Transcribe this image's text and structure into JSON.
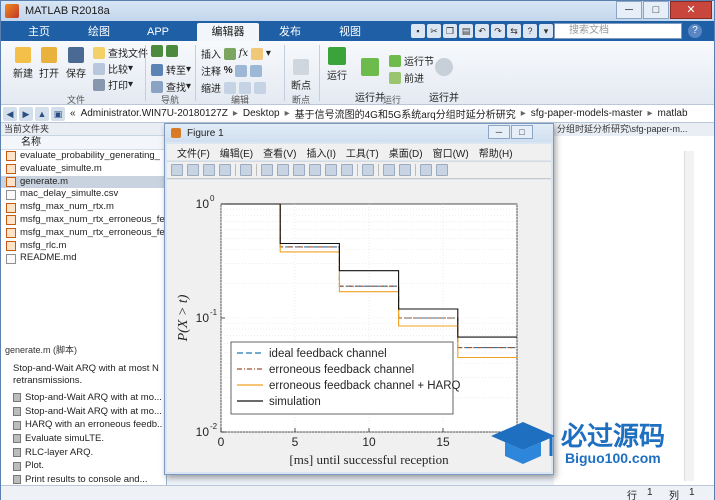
{
  "app": {
    "title": "MATLAB R2018a"
  },
  "window_controls": {
    "minimize": "─",
    "maximize": "□",
    "close": "✕"
  },
  "tabs": [
    {
      "label": "主页",
      "active": false
    },
    {
      "label": "绘图",
      "active": false
    },
    {
      "label": "APP",
      "active": false
    },
    {
      "label": "编辑器",
      "active": true
    },
    {
      "label": "发布",
      "active": false
    },
    {
      "label": "视图",
      "active": false
    }
  ],
  "search": {
    "placeholder": "搜索文档"
  },
  "ribbon": {
    "file": {
      "new": "新建",
      "open": "打开",
      "save": "保存",
      "find_files": "查找文件",
      "compare": "比较",
      "print": "打印",
      "group": "文件"
    },
    "navigate": {
      "goto": "转至",
      "find": "查找",
      "group": "导航"
    },
    "edit": {
      "insert": "插入",
      "comment": "注释",
      "indent": "缩进",
      "group": "编辑"
    },
    "breakpoints": {
      "label": "断点",
      "group": "断点"
    },
    "run": {
      "run": "运行",
      "run_advance": "运行并\n前进",
      "run_section": "运行节",
      "advance": "前进",
      "run_time": "运行并\n计时",
      "group": "运行"
    }
  },
  "address": {
    "crumbs": [
      "«",
      "Administrator.WIN7U-20180127Z",
      "Desktop",
      "基于信号流图的4G和5G系统arq分组时延分析研究",
      "sfg-paper-models-master",
      "matlab"
    ]
  },
  "current_folder": {
    "header": "当前文件夹",
    "column": "名称",
    "files": [
      {
        "name": "evaluate_probability_generating_",
        "type": "m",
        "selected": false
      },
      {
        "name": "evaluate_simulte.m",
        "type": "m",
        "selected": false
      },
      {
        "name": "generate.m",
        "type": "m",
        "selected": true
      },
      {
        "name": "mac_delay_simulte.csv",
        "type": "csv",
        "selected": false
      },
      {
        "name": "msfg_max_num_rtx.m",
        "type": "m",
        "selected": false
      },
      {
        "name": "msfg_max_num_rtx_erroneous_fee",
        "type": "m",
        "selected": false
      },
      {
        "name": "msfg_max_num_rtx_erroneous_fe",
        "type": "m",
        "selected": false
      },
      {
        "name": "msfg_rlc.m",
        "type": "m",
        "selected": false
      },
      {
        "name": "README.md",
        "type": "md",
        "selected": false
      }
    ]
  },
  "details": {
    "header": "generate.m  (脚本)",
    "text": "Stop-and-Wait ARQ with at most N retransmissions.",
    "items": [
      "Stop-and-Wait ARQ with at mo...",
      "Stop-and-Wait ARQ with at mo...",
      "HARQ with an erroneous feedb...",
      "Evaluate simuLTE.",
      "RLC-layer ARQ.",
      "Plot.",
      "Print results to console and..."
    ]
  },
  "editor_tab": {
    "label": "分组时延分析研究\\sfg-paper-m..."
  },
  "status": {
    "row_label": "行",
    "row_value": "1",
    "col_label": "列",
    "col_value": "1"
  },
  "figure": {
    "title": "Figure 1",
    "menu": [
      "文件(F)",
      "编辑(E)",
      "查看(V)",
      "插入(I)",
      "工具(T)",
      "桌面(D)",
      "窗口(W)",
      "帮助(H)"
    ]
  },
  "chart_data": {
    "type": "line",
    "xlabel": "[ms]  until successful reception",
    "ylabel": "P(X > t)",
    "xlim": [
      0,
      20
    ],
    "ylim": [
      0.01,
      1
    ],
    "yscale": "log",
    "x_ticks": [
      0,
      5,
      10,
      15
    ],
    "y_ticks": [
      {
        "value": 1,
        "label_base": "10",
        "label_exp": "0"
      },
      {
        "value": 0.1,
        "label_base": "10",
        "label_exp": "-1"
      },
      {
        "value": 0.01,
        "label_base": "10",
        "label_exp": "-2"
      }
    ],
    "grid": true,
    "legend_position": "bottom-left",
    "series": [
      {
        "name": "ideal feedback channel",
        "color": "#1f77b4",
        "dash": "6,3",
        "x": [
          0,
          4,
          4,
          8,
          8,
          12,
          12,
          16,
          16,
          20
        ],
        "y": [
          1,
          1,
          0.42,
          0.42,
          0.19,
          0.19,
          0.1,
          0.1,
          0.055,
          0.055
        ]
      },
      {
        "name": "erroneous feedback channel",
        "color": "#a0522d",
        "dash": "5,2,1,2",
        "x": [
          0,
          4,
          4,
          8,
          8,
          12,
          12,
          16,
          16,
          20
        ],
        "y": [
          1,
          1,
          0.42,
          0.42,
          0.19,
          0.19,
          0.1,
          0.1,
          0.055,
          0.055
        ]
      },
      {
        "name": "erroneous feedback channel + HARQ",
        "color": "#f0a020",
        "dash": "",
        "x": [
          0,
          4,
          4,
          8,
          8,
          12,
          12,
          16,
          16,
          20
        ],
        "y": [
          1,
          1,
          0.38,
          0.38,
          0.17,
          0.17,
          0.085,
          0.085,
          0.045,
          0.045
        ]
      },
      {
        "name": "simulation",
        "color": "#111111",
        "dash": "",
        "x": [
          0,
          4,
          4,
          8,
          8,
          12,
          12,
          16,
          16,
          20
        ],
        "y": [
          1,
          1,
          0.45,
          0.45,
          0.26,
          0.26,
          0.12,
          0.12,
          0.068,
          0.068
        ]
      }
    ]
  },
  "watermark": {
    "main": "必过源码",
    "sub": "Biguo100.com"
  }
}
